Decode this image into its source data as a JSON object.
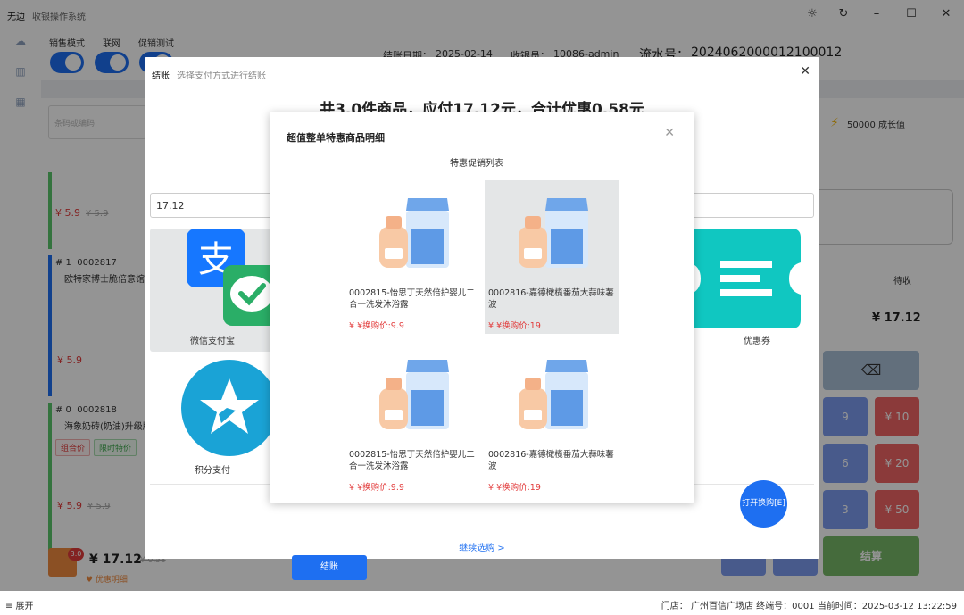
{
  "app": {
    "name": "无边",
    "subtitle": "收银操作系统"
  },
  "window": {
    "theme_icon": "sun-icon",
    "refresh_icon": "refresh-icon",
    "minimize_icon": "minimize-icon",
    "maximize_icon": "maximize-icon",
    "close_icon": "close-icon"
  },
  "header": {
    "toggles": [
      {
        "label": "销售模式",
        "on": true
      },
      {
        "label": "联网",
        "on": true
      },
      {
        "label": "促销测试",
        "on": true
      }
    ],
    "date_label": "结账日期：",
    "date_value": "2025-02-14",
    "cashier_label": "收银员：",
    "cashier_value": "10086-admin",
    "serial_label": "流水号：",
    "serial_value": "2024062000012100012"
  },
  "background": {
    "search_placeholder": "条码或编码",
    "growth": "50000 成长值",
    "pending_label": "待收",
    "pending_amount": "¥ 17.12",
    "items": [
      {
        "price": "¥ 5.9",
        "orig": "¥ 5.9"
      },
      {
        "index": "# 1",
        "code": "0002817",
        "name": "欧特家博士脆倍意馆",
        "price": "¥ 5.9"
      },
      {
        "index": "# 0",
        "code": "0002818",
        "name": "海象奶砖(奶油)升级版",
        "tags": [
          "组合价",
          "限时特价"
        ],
        "price": "¥ 5.9",
        "orig": "¥ 5.9"
      }
    ],
    "cart_count": "3.0",
    "cart_total": "¥ 17.12",
    "cart_orig": "¥ 0.58",
    "discount_detail": "♥ 优惠明细",
    "keypad": [
      "9",
      "¥ 10",
      "6",
      "¥ 20",
      "3",
      "¥ 50"
    ],
    "settle": "结算"
  },
  "checkout": {
    "title": "结账",
    "subtitle": "选择支付方式进行结账",
    "summary": "共3.0件商品，应付17.12元，合计优惠0.58元",
    "amount_value": "17.12",
    "methods": [
      {
        "label": "微信支付宝"
      },
      {
        "label": "积分支付"
      },
      {
        "label": "优惠券"
      }
    ],
    "pay_button": "结账",
    "continue_link": "继续选购 >"
  },
  "detail": {
    "title": "超值整单特惠商品明细",
    "section_label": "特惠促销列表",
    "products": [
      {
        "name": "0002815-怡思丁天然倍护婴儿二合一洗发沐浴露",
        "price": "¥  ¥换购价:9.9",
        "selected": false
      },
      {
        "name": "0002816-嘉德橄榄番茄大蒜味薯波",
        "price": "¥  ¥换购价:19",
        "selected": true
      },
      {
        "name": "0002815-怡思丁天然倍护婴儿二合一洗发沐浴露",
        "price": "¥  ¥换购价:9.9",
        "selected": false
      },
      {
        "name": "0002816-嘉德橄榄番茄大蒜味薯波",
        "price": "¥  ¥换购价:19",
        "selected": false
      }
    ]
  },
  "fab_label": "打开换购[E]",
  "status": {
    "expand": "≡ 展开",
    "store": "门店：  广州百信广场店  终端号：0001  当前时间：2025-03-12 13:22:59"
  },
  "colors": {
    "primary": "#1e6ff1",
    "danger": "#e23b3b",
    "alipay": "#1677ff",
    "wechat": "#2aae67",
    "coupon": "#10c7c1",
    "star": "#1aa3d6"
  }
}
